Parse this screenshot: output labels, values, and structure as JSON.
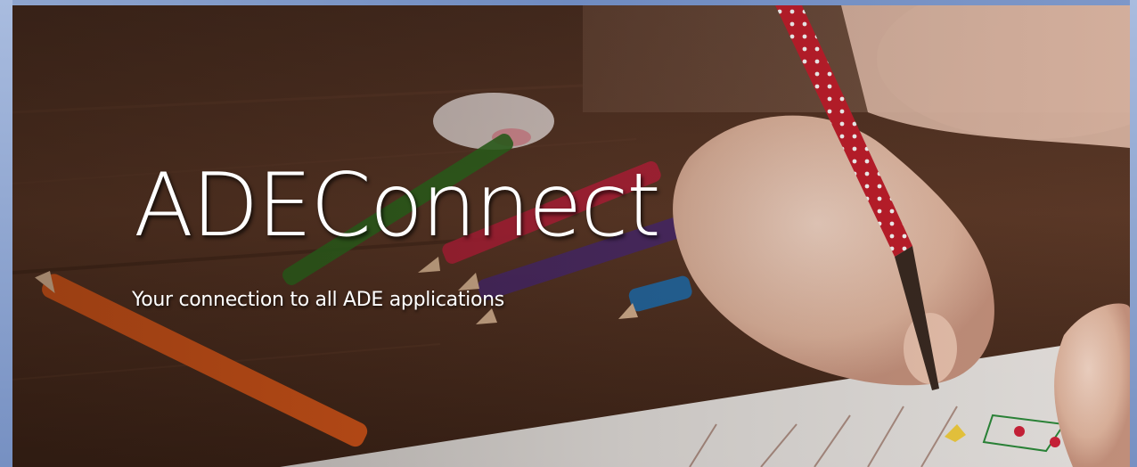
{
  "hero": {
    "title": "ADEConnect",
    "subtitle": "Your connection to all ADE applications",
    "image_subject": "child drawing with colored pencils"
  },
  "colors": {
    "frame": "#7d97c8",
    "text": "#ffffff",
    "background_dark": "#3b2419"
  }
}
